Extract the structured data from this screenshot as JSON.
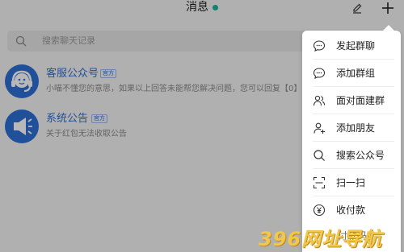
{
  "header": {
    "title": "消息"
  },
  "search": {
    "placeholder": "搜索聊天记录"
  },
  "conversations": [
    {
      "name": "客服公众号",
      "badge": "官方",
      "preview": "小喵不懂您的意思，如果以上回答未能帮您解决问题，您可以回复【0】",
      "icon": "headset-icon"
    },
    {
      "name": "系统公告",
      "badge": "官方",
      "preview": "关于红包无法收取公告",
      "icon": "megaphone-icon"
    }
  ],
  "menu": {
    "items": [
      {
        "label": "发起群聊",
        "icon": "chat-bubble-icon"
      },
      {
        "label": "添加群组",
        "icon": "chat-bubble-icon"
      },
      {
        "label": "面对面建群",
        "icon": "users-icon"
      },
      {
        "label": "添加朋友",
        "icon": "add-user-icon"
      },
      {
        "label": "搜索公众号",
        "icon": "search-icon"
      },
      {
        "label": "扫一扫",
        "icon": "scan-icon"
      },
      {
        "label": "收付款",
        "icon": "yen-icon"
      }
    ]
  },
  "watermark": {
    "logo": "396网址导航",
    "under_text": "付款码"
  },
  "colors": {
    "accent": "#2f6fd6",
    "online": "#19b39a",
    "watermark": "#f0c850"
  }
}
